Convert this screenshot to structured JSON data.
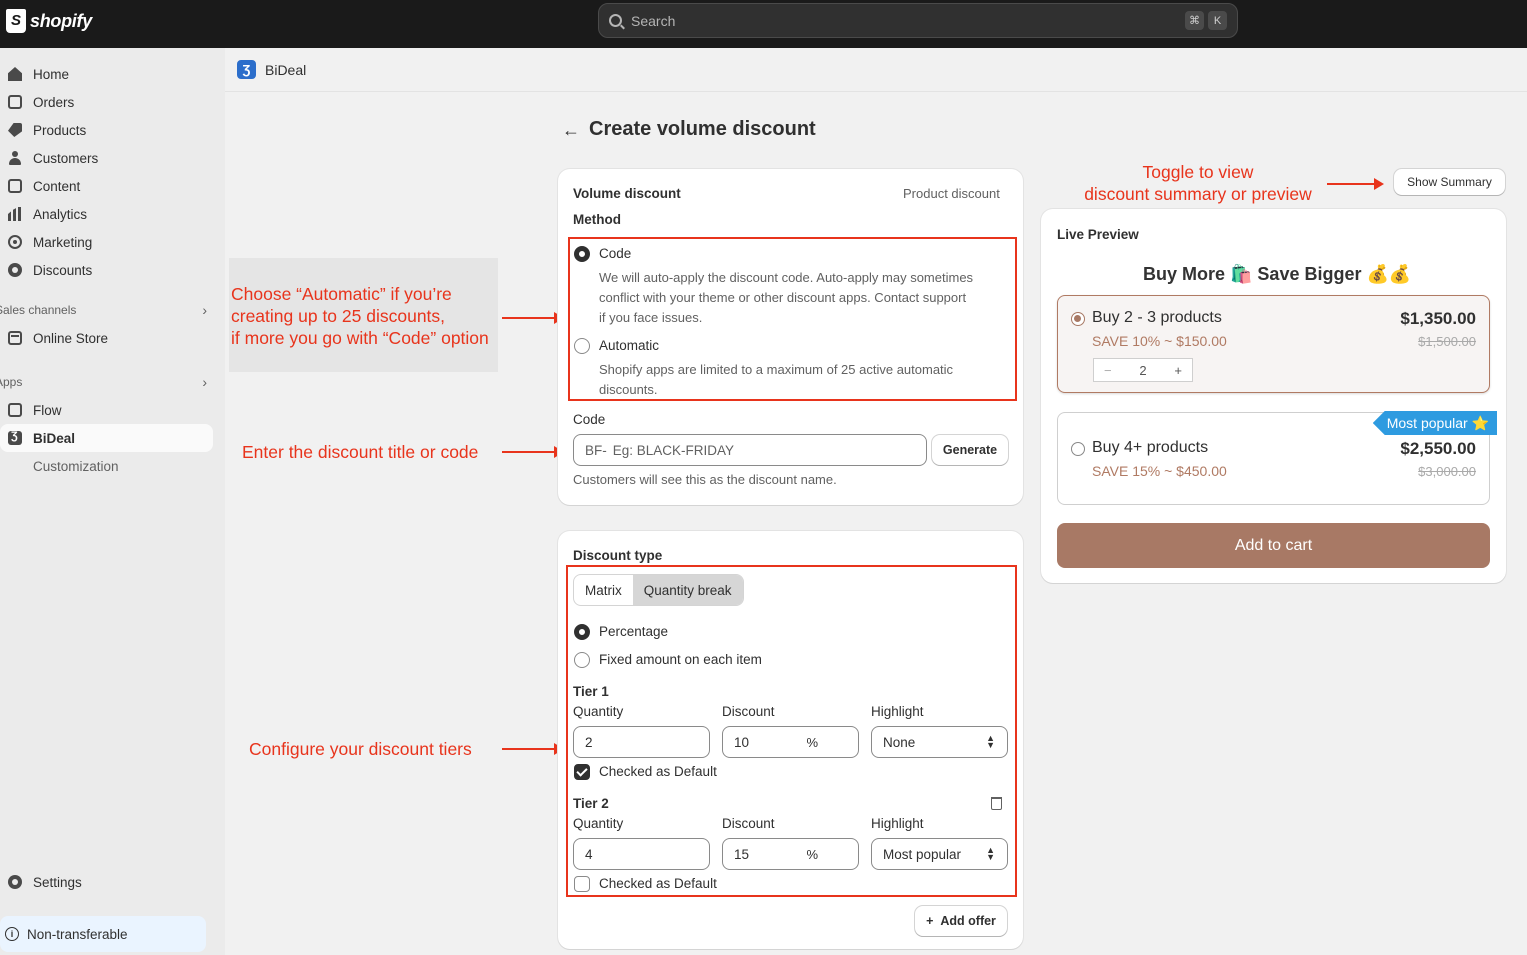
{
  "topbar": {
    "logo": "shopify",
    "search_placeholder": "Search",
    "kbd1": "⌘",
    "kbd2": "K"
  },
  "sidebar": {
    "items": [
      {
        "label": "Home"
      },
      {
        "label": "Orders"
      },
      {
        "label": "Products"
      },
      {
        "label": "Customers"
      },
      {
        "label": "Content"
      },
      {
        "label": "Analytics"
      },
      {
        "label": "Marketing"
      },
      {
        "label": "Discounts"
      }
    ],
    "sales_channels_label": "Sales channels",
    "online_store": "Online Store",
    "apps_label": "Apps",
    "flow": "Flow",
    "bideal": "BiDeal",
    "customization": "Customization",
    "settings": "Settings",
    "non_transferable": "Non-transferable"
  },
  "appbar": {
    "title": "BiDeal",
    "logo_glyph": "Ʒ"
  },
  "page": {
    "title": "Create volume discount"
  },
  "annotations": {
    "automatic": [
      "Choose “Automatic” if you’re",
      "creating up to 25 discounts,",
      "if more you go with “Code” option"
    ],
    "code": "Enter the discount title or code",
    "tiers": "Configure your discount tiers",
    "toggle": [
      "Toggle to view",
      "discount summary or preview"
    ]
  },
  "volume_card": {
    "title": "Volume discount",
    "type": "Product discount",
    "method_label": "Method",
    "code_option": "Code",
    "code_desc": [
      "We will auto-apply the discount code. Auto-apply may sometimes",
      "conflict with your theme or other discount apps. Contact support",
      "if you face issues."
    ],
    "automatic_option": "Automatic",
    "automatic_desc": [
      "Shopify apps are limited to a maximum of 25 active automatic",
      "discounts."
    ],
    "code_label": "Code",
    "code_prefix": "BF-",
    "code_placeholder": "Eg: BLACK-FRIDAY",
    "generate": "Generate",
    "help": "Customers will see this as the discount name."
  },
  "discount_card": {
    "title": "Discount type",
    "seg_matrix": "Matrix",
    "seg_quantity": "Quantity break",
    "percentage": "Percentage",
    "fixed": "Fixed amount on each item",
    "quantity_label": "Quantity",
    "discount_label": "Discount",
    "highlight_label": "Highlight",
    "percent_suffix": "%",
    "checked_default": "Checked as Default",
    "tiers": [
      {
        "name": "Tier 1",
        "quantity": "2",
        "discount": "10",
        "highlight": "None",
        "default": true
      },
      {
        "name": "Tier 2",
        "quantity": "4",
        "discount": "15",
        "highlight": "Most popular",
        "default": false
      }
    ],
    "add_offer": "Add offer"
  },
  "preview": {
    "show_summary": "Show Summary",
    "label": "Live Preview",
    "headline": "Buy More 🛍️ Save Bigger 💰💰",
    "tiers": [
      {
        "name": "Buy 2 - 3 products",
        "save": "SAVE 10% ~ $150.00",
        "price": "$1,350.00",
        "old": "$1,500.00",
        "qty": "2"
      },
      {
        "name": "Buy 4+ products",
        "save": "SAVE 15% ~ $450.00",
        "price": "$2,550.00",
        "old": "$3,000.00",
        "badge": "Most popular ⭐"
      }
    ],
    "add_to_cart": "Add to cart"
  },
  "colors": {
    "accent": "#a87965",
    "annotation": "#e8341c",
    "badge": "#2e9be0"
  }
}
